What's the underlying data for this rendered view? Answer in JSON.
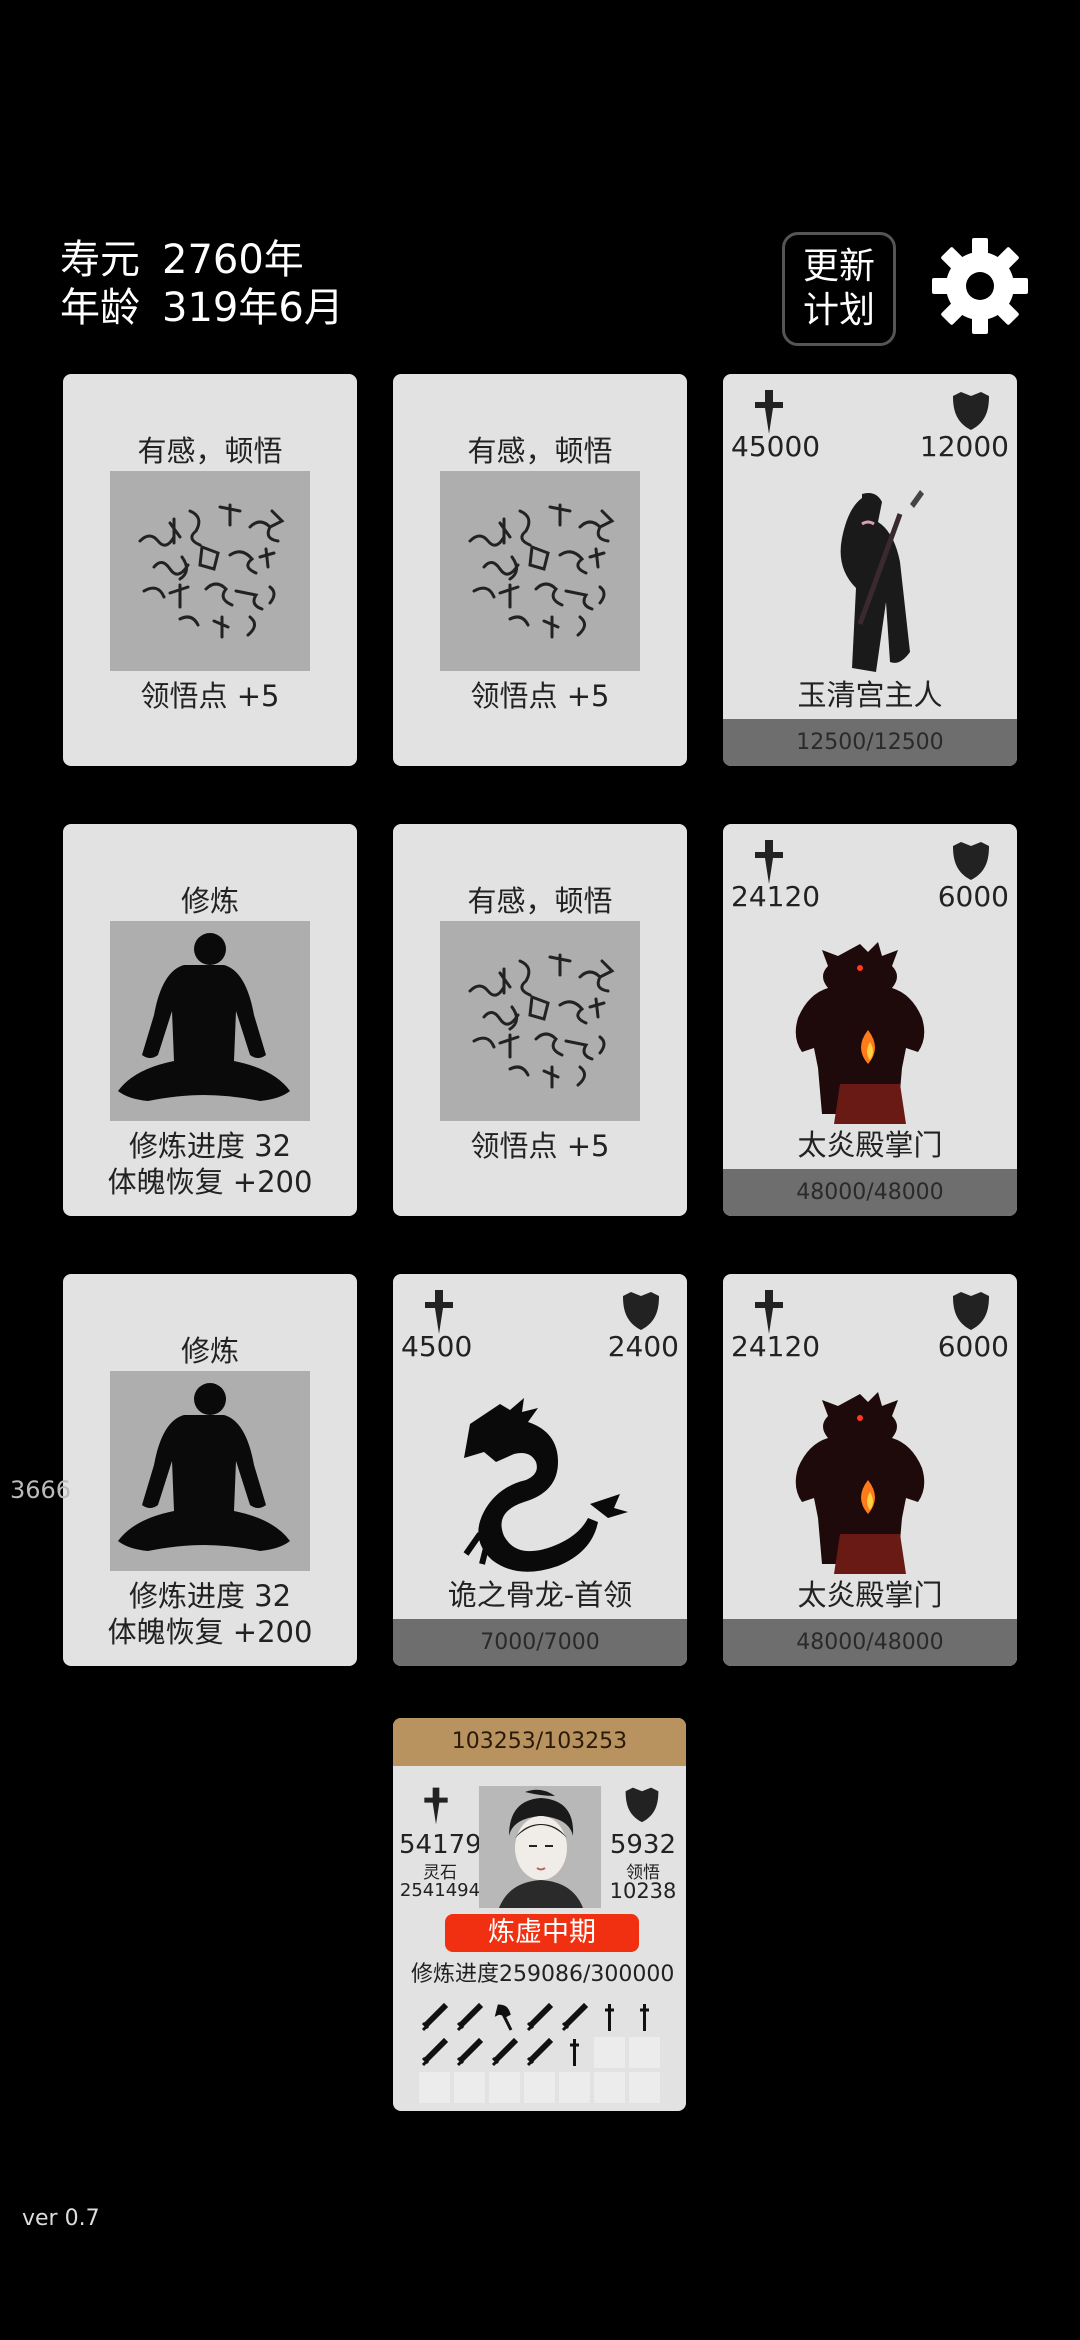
{
  "header": {
    "lifespan_label": "寿元",
    "lifespan_value": "2760年",
    "age_label": "年龄",
    "age_value": "319年6月",
    "update_line1": "更新",
    "update_line2": "计划"
  },
  "cards": {
    "c1": {
      "title": "有感，顿悟",
      "line1": "领悟点  +5"
    },
    "c2": {
      "title": "有感，顿悟",
      "line1": "领悟点  +5"
    },
    "c3": {
      "atk": "45000",
      "def": "12000",
      "name": "玉清宫主人",
      "hp": "12500/12500"
    },
    "c4": {
      "title": "修炼",
      "line1": "修炼进度  32",
      "line2": "体魄恢复  +200"
    },
    "c5": {
      "title": "有感，顿悟",
      "line1": "领悟点  +5"
    },
    "c6": {
      "atk": "24120",
      "def": "6000",
      "name": "太炎殿掌门",
      "hp": "48000/48000"
    },
    "c7": {
      "title": "修炼",
      "line1": "修炼进度  32",
      "line2": "体魄恢复  +200"
    },
    "c8": {
      "atk": "4500",
      "def": "2400",
      "name": "诡之骨龙-首领",
      "hp": "7000/7000"
    },
    "c9": {
      "atk": "24120",
      "def": "6000",
      "name": "太炎殿掌门",
      "hp": "48000/48000"
    }
  },
  "side_number": "3666",
  "player": {
    "hp": "103253/103253",
    "atk": "54179",
    "def": "5932",
    "lingshi_label": "灵石",
    "lingshi_value": "2541494",
    "lingwu_label": "领悟",
    "lingwu_value": "10238",
    "realm": "炼虚中期",
    "progress_label": "修炼进度",
    "progress_value": "259086/300000",
    "equipment_slots": [
      "sword-icon",
      "sword-icon",
      "axe-icon",
      "sword-icon",
      "sword-icon",
      "dagger-icon",
      "dagger-icon",
      "sword-icon",
      "sword-icon",
      "sword-icon",
      "sword-icon",
      "dagger-icon",
      "empty",
      "empty",
      "empty",
      "empty",
      "empty",
      "empty",
      "empty",
      "empty",
      "empty"
    ]
  },
  "version": "ver 0.7",
  "colors": {
    "background": "#000000",
    "card": "#e2e2e2",
    "art_bg": "#aeaeae",
    "hpbar": "#6e6e6e",
    "player_hp": "#b8935f",
    "realm": "#f03010"
  }
}
